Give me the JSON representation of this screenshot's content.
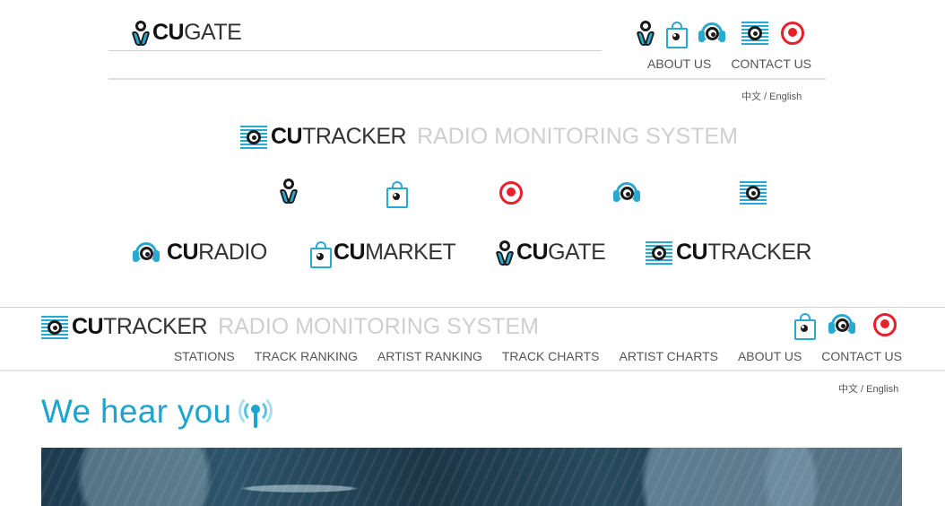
{
  "header1": {
    "logo": {
      "bold": "CU",
      "light": "GATE"
    },
    "nav": [
      "ABOUT US",
      "CONTACT US"
    ],
    "lang": "中文 / English",
    "icons": [
      "cugate-icon",
      "cumarket-icon",
      "curadio-icon",
      "cutracker-icon",
      "record-icon"
    ]
  },
  "section2": {
    "title_logo": {
      "bold": "CU",
      "light": "TRACKER",
      "sub": "RADIO MONITORING SYSTEM"
    },
    "icons": [
      "cugate-icon",
      "cumarket-icon",
      "record-icon",
      "curadio-icon",
      "cutracker-icon"
    ],
    "logos": [
      {
        "bold": "CU",
        "light": "RADIO"
      },
      {
        "bold": "CU",
        "light": "MARKET"
      },
      {
        "bold": "CU",
        "light": "GATE"
      },
      {
        "bold": "CU",
        "light": "TRACKER"
      }
    ]
  },
  "section3": {
    "logo": {
      "bold": "CU",
      "light": "TRACKER",
      "sub": "RADIO MONITORING SYSTEM"
    },
    "nav": [
      "STATIONS",
      "TRACK RANKING",
      "ARTIST RANKING",
      "TRACK CHARTS",
      "ARTIST CHARTS",
      "ABOUT US",
      "CONTACT US"
    ],
    "lang": "中文 / English",
    "hero_title": "We hear you"
  },
  "colors": {
    "accent": "#1ea4cf",
    "red": "#e8202a",
    "text": "#555555"
  }
}
